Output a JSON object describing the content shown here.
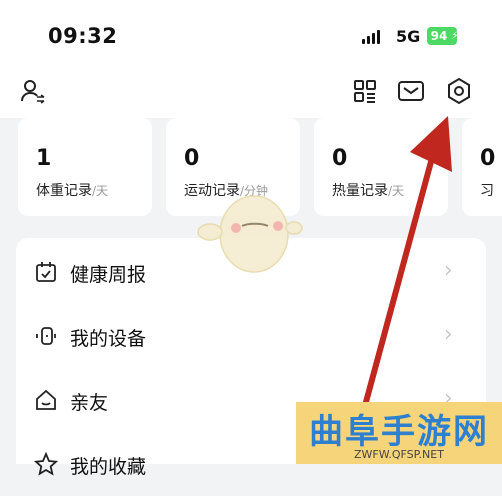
{
  "status_bar": {
    "time": "09:32",
    "network": "5G",
    "battery": "94",
    "battery_color": "#4cd964"
  },
  "toolbar": {
    "left_icon": "user-switch-icon",
    "right_icons": [
      "qr-code-icon",
      "mail-icon",
      "settings-icon"
    ]
  },
  "stats": [
    {
      "value": "1",
      "label": "体重记录",
      "unit": "/天"
    },
    {
      "value": "0",
      "label": "运动记录",
      "unit": "/分钟"
    },
    {
      "value": "0",
      "label": "热量记录",
      "unit": "/天"
    },
    {
      "value": "0",
      "label": "习",
      "unit": ""
    }
  ],
  "menu": [
    {
      "label": "健康周报",
      "icon": "calendar-icon"
    },
    {
      "label": "我的设备",
      "icon": "device-icon"
    },
    {
      "label": "亲友",
      "icon": "home-icon"
    },
    {
      "label": "我的收藏",
      "icon": "star-icon"
    }
  ],
  "annotation": {
    "arrow_color": "#c0281f"
  },
  "watermark": {
    "title": "曲阜手游网",
    "url": "ZWFW.QFSP.NET"
  }
}
